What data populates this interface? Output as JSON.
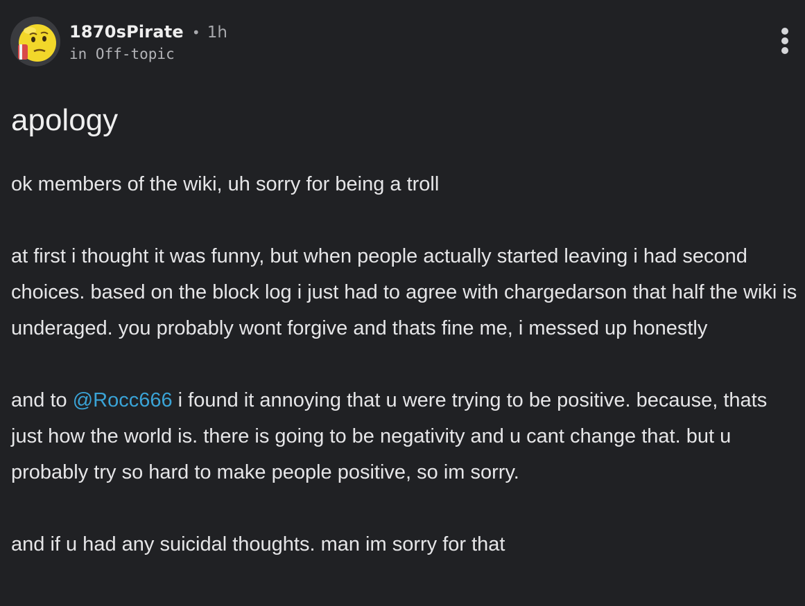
{
  "post": {
    "author": "1870sPirate",
    "separator": "•",
    "time_ago": "1h",
    "category": "in Off-topic",
    "title": "apology",
    "paragraphs": [
      {
        "parts": [
          {
            "text": " ok members of the wiki, uh sorry for being a troll"
          }
        ]
      },
      {
        "parts": [
          {
            "text": " at first i thought it was funny, but when people actually started leaving i had second choices. based on the block log i just had to agree with chargedarson that half the wiki is underaged. you probably wont forgive and thats fine me, i messed up honestly"
          }
        ]
      },
      {
        "parts": [
          {
            "text": " and to "
          },
          {
            "text": "@Rocc666",
            "mention": true
          },
          {
            "text": " i found it annoying that u were trying to be positive. because, thats just how the world is. there is going to be negativity and u cant change that. but u probably try so hard to make people positive, so im sorry."
          }
        ]
      },
      {
        "parts": [
          {
            "text": " and if u had any suicidal thoughts. man im sorry for that"
          }
        ]
      }
    ]
  },
  "icons": {
    "avatar": "yellow-face-avatar",
    "more": "vertical-ellipsis-icon"
  },
  "colors": {
    "background": "#202124",
    "text": "#e6e6e8",
    "muted": "#a8a9ad",
    "mention": "#3aa3d6"
  }
}
